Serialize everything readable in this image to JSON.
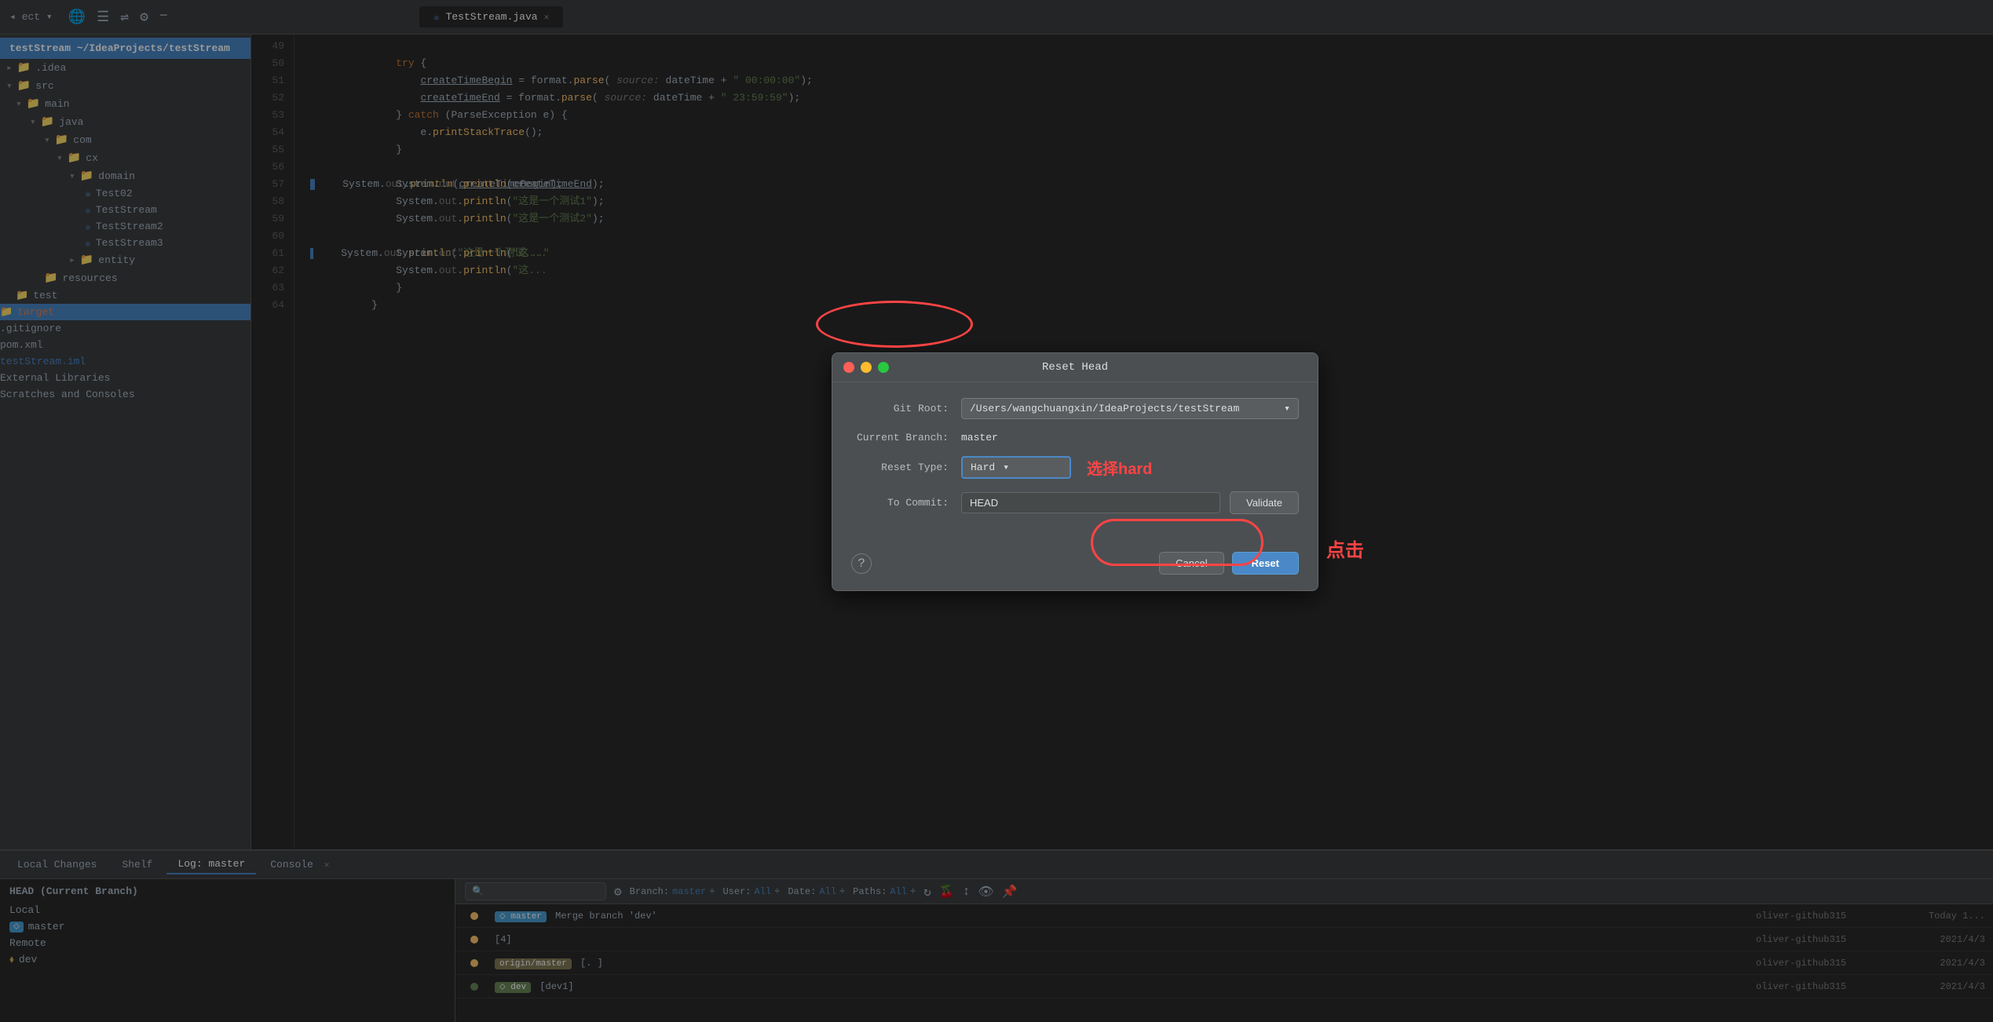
{
  "app": {
    "title": "testStream",
    "project_path": "~/IdeaProjects/testStream",
    "tab_label": "TestStream.java"
  },
  "sidebar": {
    "title": "testStream ~/IdeaProjects/testStream",
    "items": [
      {
        "id": "idea",
        "label": ".idea",
        "indent": 0,
        "type": "folder"
      },
      {
        "id": "src",
        "label": "src",
        "indent": 0,
        "type": "folder"
      },
      {
        "id": "main",
        "label": "main",
        "indent": 1,
        "type": "folder"
      },
      {
        "id": "java",
        "label": "java",
        "indent": 2,
        "type": "folder"
      },
      {
        "id": "com",
        "label": "com",
        "indent": 3,
        "type": "folder"
      },
      {
        "id": "cx",
        "label": "cx",
        "indent": 4,
        "type": "folder"
      },
      {
        "id": "domain",
        "label": "domain",
        "indent": 5,
        "type": "folder"
      },
      {
        "id": "Test02",
        "label": "Test02",
        "indent": 6,
        "type": "java"
      },
      {
        "id": "TestStream",
        "label": "TestStream",
        "indent": 6,
        "type": "java"
      },
      {
        "id": "TestStream2",
        "label": "TestStream2",
        "indent": 6,
        "type": "java"
      },
      {
        "id": "TestStream3",
        "label": "TestStream3",
        "indent": 6,
        "type": "java"
      },
      {
        "id": "entity",
        "label": "entity",
        "indent": 5,
        "type": "folder"
      },
      {
        "id": "resources",
        "label": "resources",
        "indent": 3,
        "type": "folder"
      },
      {
        "id": "test",
        "label": "test",
        "indent": 1,
        "type": "folder-green"
      },
      {
        "id": "target",
        "label": "target",
        "indent": 0,
        "type": "folder-orange"
      },
      {
        "id": "gitignore",
        "label": ".gitignore",
        "indent": 0,
        "type": "file"
      },
      {
        "id": "pomxml",
        "label": "pom.xml",
        "indent": 0,
        "type": "file"
      },
      {
        "id": "testStreamiml",
        "label": "testStream.iml",
        "indent": 0,
        "type": "file-blue"
      },
      {
        "id": "extlibs",
        "label": "External Libraries",
        "indent": 0,
        "type": "folder"
      },
      {
        "id": "scratches",
        "label": "Scratches and Consoles",
        "indent": 0,
        "type": "folder"
      }
    ]
  },
  "code": {
    "lines": [
      {
        "num": 49,
        "content": "    try {"
      },
      {
        "num": 50,
        "content": "        createTimeBegin = format.parse( source: dateTime + \" 00:00:00\");"
      },
      {
        "num": 51,
        "content": "        createTimeEnd = format.parse( source: dateTime + \" 23:59:59\");"
      },
      {
        "num": 52,
        "content": "    } catch (ParseException e) {"
      },
      {
        "num": 53,
        "content": "        e.printStackTrace();"
      },
      {
        "num": 54,
        "content": "    }"
      },
      {
        "num": 55,
        "content": "    System.out.println(createTimeBegin);"
      },
      {
        "num": 56,
        "content": "    System.out.println(createTimeEnd);"
      },
      {
        "num": 57,
        "content": "    System.out.println(\"这是一个测试1\");"
      },
      {
        "num": 58,
        "content": "    System.out.println(\"这是一个测试2\");"
      },
      {
        "num": 59,
        "content": "    System.out.println(\"这是一个测试..."
      },
      {
        "num": 60,
        "content": "    System.out.println(\"这..."
      },
      {
        "num": 61,
        "content": "    System.out.println(\"这..."
      },
      {
        "num": 62,
        "content": "    }"
      },
      {
        "num": 63,
        "content": "}"
      },
      {
        "num": 64,
        "content": ""
      }
    ]
  },
  "modal": {
    "title": "Reset Head",
    "git_root_label": "Git Root:",
    "git_root_value": "/Users/wangchuangxin/IdeaProjects/testStream",
    "current_branch_label": "Current Branch:",
    "current_branch_value": "master",
    "reset_type_label": "Reset Type:",
    "reset_type_value": "Hard",
    "to_commit_label": "To Commit:",
    "to_commit_value": "HEAD",
    "validate_label": "Validate",
    "cancel_label": "Cancel",
    "reset_label": "Reset",
    "annotation_hard": "选择hard",
    "annotation_click": "点击"
  },
  "bottom": {
    "tabs": [
      {
        "label": "Local Changes",
        "active": false
      },
      {
        "label": "Shelf",
        "active": false
      },
      {
        "label": "Log: master",
        "active": true
      },
      {
        "label": "Console",
        "active": false,
        "closable": true
      }
    ],
    "left": {
      "head_label": "HEAD (Current Branch)",
      "local_label": "Local",
      "master_branch": "master",
      "remote_label": "Remote",
      "dev_branch": "dev"
    },
    "toolbar": {
      "search_placeholder": "🔍",
      "branch_filter": "Branch: master ÷",
      "user_filter": "User: All ÷",
      "date_filter": "Date: All ÷",
      "paths_filter": "Paths: All ÷"
    },
    "log_entries": [
      {
        "msg": "Merge branch 'dev'",
        "branch_tag": "master",
        "author": "oliver-github315",
        "date": "Today 1..."
      },
      {
        "msg": "[4]",
        "author": "oliver-github315",
        "date": "2021/4/3"
      },
      {
        "msg": "[. ]",
        "author": "oliver-github315",
        "date": "2021/4/3",
        "origin_tag": "origin/master"
      },
      {
        "msg": "[dev1]",
        "branch_tag_green": "dev",
        "author": "oliver-github315",
        "date": "2021/4/3"
      }
    ]
  },
  "icons": {
    "close": "✕",
    "chevron_down": "▾",
    "search": "🔍",
    "gear": "⚙",
    "refresh": "↻",
    "branch": "⎇",
    "arrow_up": "↑",
    "arrow_down": "↓",
    "eye": "👁",
    "help": "?",
    "folder_open": "▾ 📁",
    "folder_closed": "▸ 📁"
  },
  "colors": {
    "accent": "#4a88c7",
    "bg_dark": "#2b2b2b",
    "bg_medium": "#3c3f41",
    "text_primary": "#a9b7c6",
    "branch_tag": "#4a9fd4",
    "green": "#6a8759",
    "orange": "#e8834d",
    "red": "#ff4444"
  }
}
